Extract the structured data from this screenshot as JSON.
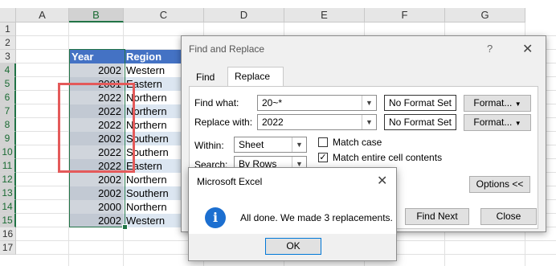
{
  "sheet": {
    "columns": [
      "A",
      "B",
      "C",
      "D",
      "E",
      "F",
      "G"
    ],
    "rows": [
      "1",
      "2",
      "3",
      "4",
      "5",
      "6",
      "7",
      "8",
      "9",
      "10",
      "11",
      "12",
      "13",
      "14",
      "15",
      "16",
      "17"
    ],
    "table_headers": {
      "year": "Year",
      "region": "Region"
    },
    "data": [
      {
        "year": "2002",
        "region": "Western"
      },
      {
        "year": "2001",
        "region": "Eastern"
      },
      {
        "year": "2022",
        "region": "Northern"
      },
      {
        "year": "2022",
        "region": "Northern"
      },
      {
        "year": "2022",
        "region": "Northern"
      },
      {
        "year": "2002",
        "region": "Southern"
      },
      {
        "year": "2022",
        "region": "Southern"
      },
      {
        "year": "2022",
        "region": "Eastern"
      },
      {
        "year": "2002",
        "region": "Northern"
      },
      {
        "year": "2002",
        "region": "Southern"
      },
      {
        "year": "2000",
        "region": "Northern"
      },
      {
        "year": "2002",
        "region": "Western"
      }
    ]
  },
  "find_replace": {
    "title": "Find and Replace",
    "help": "?",
    "close": "✕",
    "tabs": {
      "find": "Find",
      "replace": "Replace"
    },
    "find_what_label": "Find what:",
    "find_what_value": "20~*",
    "replace_with_label": "Replace with:",
    "replace_with_value": "2022",
    "no_format_1": "No Format Set",
    "no_format_2": "No Format Set",
    "format_btn_1": "Format...",
    "format_btn_2": "Format...",
    "within_label": "Within:",
    "within_value": "Sheet",
    "search_label": "Search:",
    "search_value": "By Rows",
    "match_case_label": "Match case",
    "match_case_checked": false,
    "match_entire_label": "Match entire cell contents",
    "match_entire_checked": true,
    "options_btn": "Options <<",
    "find_next_btn": "Find Next",
    "close_btn": "Close"
  },
  "message_box": {
    "title": "Microsoft Excel",
    "close": "✕",
    "icon": "info-icon",
    "message": "All done. We made 3 replacements.",
    "ok_btn": "OK"
  }
}
